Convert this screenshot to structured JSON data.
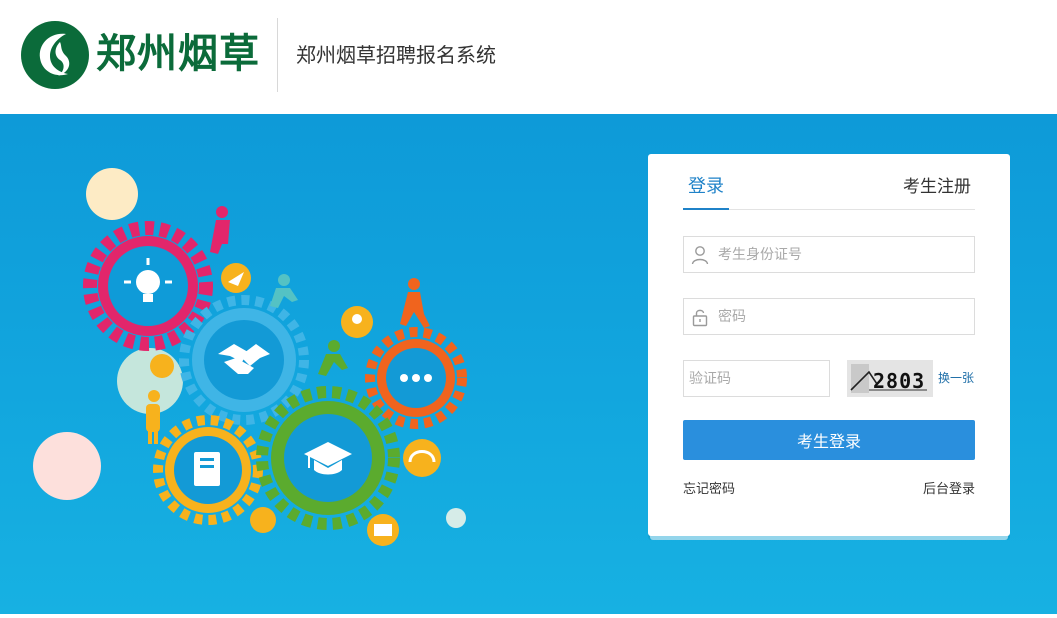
{
  "header": {
    "logo_text": "郑州烟草",
    "system_title": "郑州烟草招聘报名系统"
  },
  "login": {
    "tab_login": "登录",
    "tab_register": "考生注册",
    "id_placeholder": "考生身份证号",
    "password_placeholder": "密码",
    "captcha_placeholder": "验证码",
    "captcha_text": "2803",
    "refresh_label": "换一张",
    "submit_label": "考生登录",
    "forgot_label": "忘记密码",
    "admin_label": "后台登录"
  },
  "colors": {
    "brand_green": "#0b6b3a",
    "accent_blue": "#2a8fdd",
    "banner_blue": "#12a6de"
  },
  "icons": {
    "id": "user-icon",
    "password": "lock-icon",
    "gears": [
      "lightbulb-icon",
      "handshake-icon",
      "more-icon",
      "notebook-icon",
      "graduation-cap-icon"
    ]
  }
}
